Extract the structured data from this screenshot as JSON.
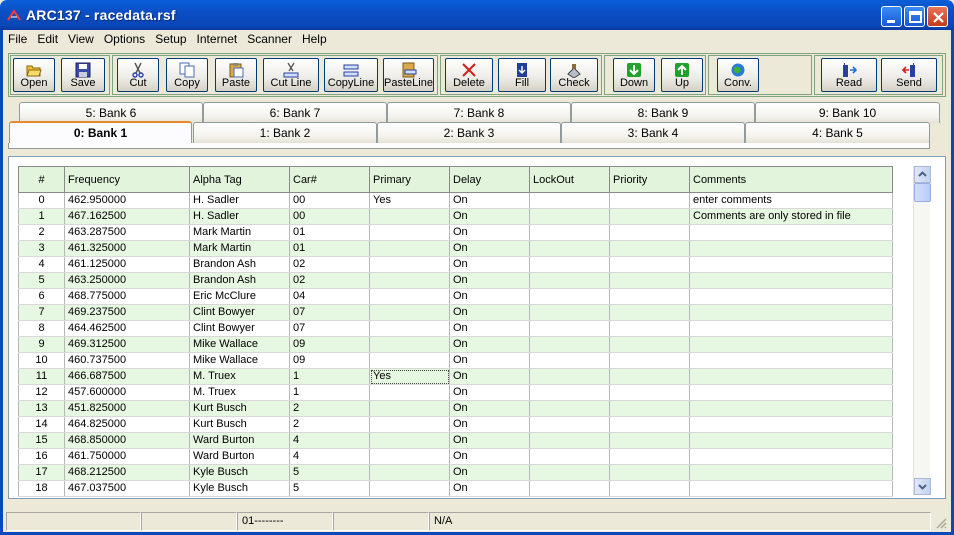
{
  "window": {
    "title": "ARC137 - racedata.rsf"
  },
  "menu": [
    "File",
    "Edit",
    "View",
    "Options",
    "Setup",
    "Internet",
    "Scanner",
    "Help"
  ],
  "toolbar": {
    "open": "Open",
    "save": "Save",
    "cut": "Cut",
    "copy": "Copy",
    "paste": "Paste",
    "cut_line": "Cut Line",
    "copy_line": "CopyLine",
    "paste_line": "PasteLine",
    "delete": "Delete",
    "fill": "Fill",
    "check": "Check",
    "down": "Down",
    "up": "Up",
    "conv": "Conv.",
    "read": "Read",
    "send": "Send"
  },
  "tabs": {
    "back": [
      "5: Bank 6",
      "6: Bank 7",
      "7: Bank 8",
      "8: Bank 9",
      "9: Bank 10"
    ],
    "front": [
      "0: Bank 1",
      "1: Bank 2",
      "2: Bank 3",
      "3: Bank 4",
      "4: Bank 5"
    ],
    "active": "0: Bank 1"
  },
  "grid": {
    "columns": [
      "#",
      "Frequency",
      "Alpha Tag",
      "Car#",
      "Primary",
      "Delay",
      "LockOut",
      "Priority",
      "Comments"
    ],
    "rows": [
      [
        "0",
        "462.950000",
        "H. Sadler",
        "00",
        "Yes",
        "On",
        "",
        "",
        "enter comments"
      ],
      [
        "1",
        "467.162500",
        "H. Sadler",
        "00",
        "",
        "On",
        "",
        "",
        "Comments are only stored in file"
      ],
      [
        "2",
        "463.287500",
        "Mark Martin",
        "01",
        "",
        "On",
        "",
        "",
        ""
      ],
      [
        "3",
        "461.325000",
        "Mark Martin",
        "01",
        "",
        "On",
        "",
        "",
        ""
      ],
      [
        "4",
        "461.125000",
        "Brandon Ash",
        "02",
        "",
        "On",
        "",
        "",
        ""
      ],
      [
        "5",
        "463.250000",
        "Brandon Ash",
        "02",
        "",
        "On",
        "",
        "",
        ""
      ],
      [
        "6",
        "468.775000",
        "Eric McClure",
        "04",
        "",
        "On",
        "",
        "",
        ""
      ],
      [
        "7",
        "469.237500",
        "Clint Bowyer",
        "07",
        "",
        "On",
        "",
        "",
        ""
      ],
      [
        "8",
        "464.462500",
        "Clint Bowyer",
        "07",
        "",
        "On",
        "",
        "",
        ""
      ],
      [
        "9",
        "469.312500",
        "Mike Wallace",
        "09",
        "",
        "On",
        "",
        "",
        ""
      ],
      [
        "10",
        "460.737500",
        "Mike Wallace",
        "09",
        "",
        "On",
        "",
        "",
        ""
      ],
      [
        "11",
        "466.687500",
        "M. Truex",
        "1",
        "Yes",
        "On",
        "",
        "",
        ""
      ],
      [
        "12",
        "457.600000",
        "M. Truex",
        "1",
        "",
        "On",
        "",
        "",
        ""
      ],
      [
        "13",
        "451.825000",
        "Kurt Busch",
        "2",
        "",
        "On",
        "",
        "",
        ""
      ],
      [
        "14",
        "464.825000",
        "Kurt Busch",
        "2",
        "",
        "On",
        "",
        "",
        ""
      ],
      [
        "15",
        "468.850000",
        "Ward Burton",
        "4",
        "",
        "On",
        "",
        "",
        ""
      ],
      [
        "16",
        "461.750000",
        "Ward Burton",
        "4",
        "",
        "On",
        "",
        "",
        ""
      ],
      [
        "17",
        "468.212500",
        "Kyle Busch",
        "5",
        "",
        "On",
        "",
        "",
        ""
      ],
      [
        "18",
        "467.037500",
        "Kyle Busch",
        "5",
        "",
        "On",
        "",
        "",
        ""
      ]
    ]
  },
  "status": {
    "cell1": "",
    "cell2": "",
    "cell3": "01--------",
    "cell4": "",
    "cell5": "N/A"
  },
  "colors": {
    "titlebar": "#0a4fc4",
    "row_alt": "#e6f7e2",
    "header": "#e2f5dc",
    "close_button": "#d9502c"
  }
}
